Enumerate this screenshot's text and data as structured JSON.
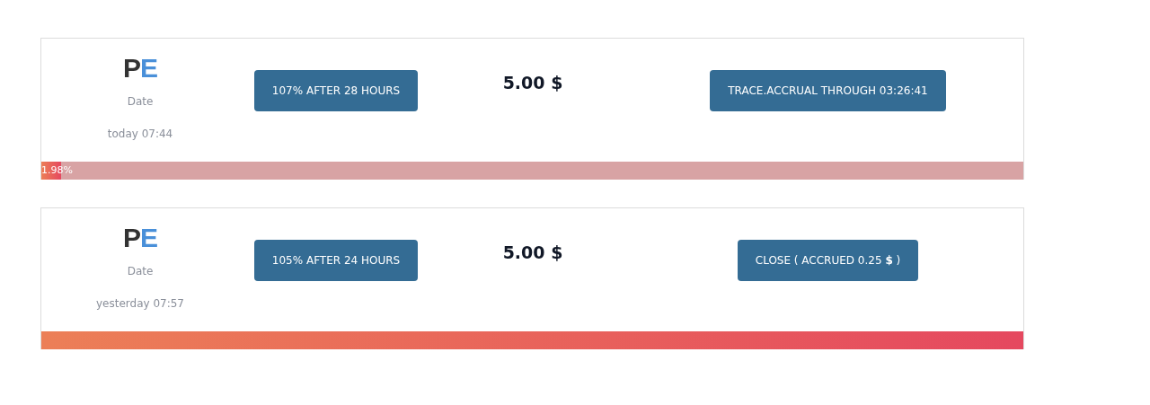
{
  "deposits": [
    {
      "logo": {
        "first": "P",
        "second": "E"
      },
      "date_label": "Date",
      "date": "today 07:44",
      "plan": "107% AFTER 28 HOURS",
      "amount": "5.00 $",
      "action": "TRACE.ACCRUAL THROUGH 03:26:41",
      "progress": {
        "level": 0.0198,
        "label": "1.98%"
      }
    },
    {
      "logo": {
        "first": "P",
        "second": "E"
      },
      "date_label": "Date",
      "date": "yesterday 07:57",
      "plan": "105% AFTER 24 HOURS",
      "amount": "5.00 $",
      "action": "CLOSE ( ACCRUED 0.25 **$** )",
      "progress": {
        "level": 1
      }
    }
  ]
}
